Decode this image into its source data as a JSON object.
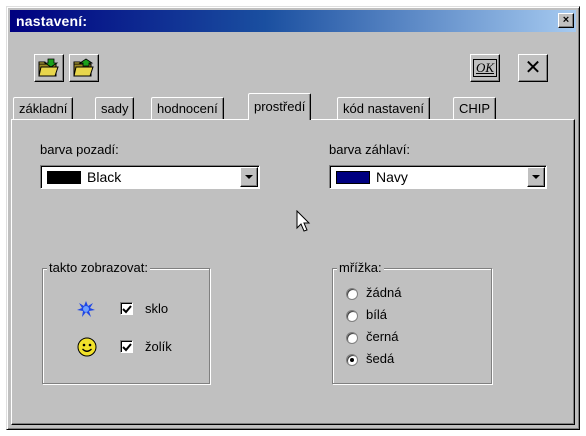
{
  "window": {
    "title": "nastavení:"
  },
  "titlebar": {
    "close_glyph": "×"
  },
  "toolbar": {
    "open_icon": "folder-open-icon",
    "save_icon": "folder-save-icon",
    "ok_label": "OK",
    "cancel_glyph": "✕"
  },
  "tabs": [
    {
      "label": "základní",
      "active": false
    },
    {
      "label": "sady",
      "active": false
    },
    {
      "label": "hodnocení",
      "active": false
    },
    {
      "label": "prostředí",
      "active": true
    },
    {
      "label": "kód nastavení",
      "active": false
    },
    {
      "label": "CHIP",
      "active": false
    }
  ],
  "background": {
    "label": "barva pozadí:",
    "value": "Black",
    "color": "#000000"
  },
  "header": {
    "label": "barva záhlaví:",
    "value": "Navy",
    "color": "#000080"
  },
  "display": {
    "legend": "takto zobrazovat:",
    "items": [
      {
        "label": "sklo",
        "checked": true,
        "icon": "glass-splash-icon"
      },
      {
        "label": "žolík",
        "checked": true,
        "icon": "smiley-joker-icon"
      }
    ]
  },
  "grid": {
    "legend": "mřížka:",
    "options": [
      {
        "label": "žádná",
        "selected": false
      },
      {
        "label": "bílá",
        "selected": false
      },
      {
        "label": "černá",
        "selected": false
      },
      {
        "label": "šedá",
        "selected": true
      }
    ]
  }
}
